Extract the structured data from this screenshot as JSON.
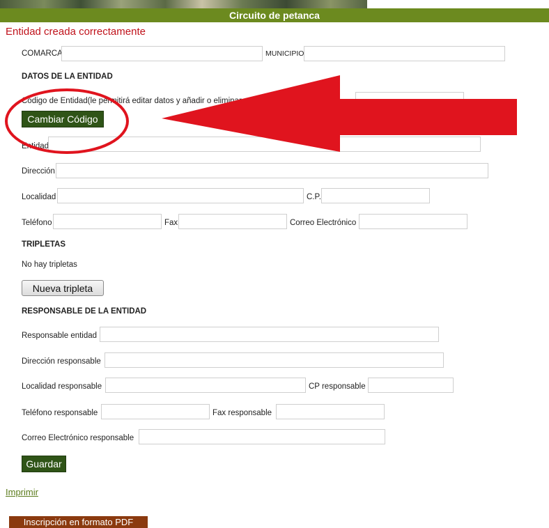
{
  "header": {
    "title": "Circuito de petanca"
  },
  "status": {
    "message": "Entidad creada correctamente"
  },
  "location": {
    "comarca_label": "COMARCA",
    "comarca_value": "",
    "municipio_label": "MUNICIPIO",
    "municipio_value": ""
  },
  "entity": {
    "section_title": "DATOS DE LA ENTIDAD",
    "code_label": "Código de Entidad(le permitirá editar datos y añadir o eliminar",
    "code_value": "",
    "change_code_button": "Cambiar Código",
    "name_label": "Entidad",
    "name_value": "",
    "address_label": "Dirección",
    "address_value": "",
    "locality_label": "Localidad",
    "locality_value": "",
    "cp_label": "C.P.",
    "cp_value": "",
    "phone_label": "Teléfono",
    "phone_value": "",
    "fax_label": "Fax",
    "fax_value": "",
    "email_label": "Correo Electrónico",
    "email_value": ""
  },
  "triplets": {
    "section_title": "TRIPLETAS",
    "empty_text": "No hay tripletas",
    "new_button": "Nueva tripleta"
  },
  "responsible": {
    "section_title": "RESPONSABLE DE LA ENTIDAD",
    "name_label": "Responsable entidad",
    "name_value": "",
    "address_label": "Dirección responsable",
    "address_value": "",
    "locality_label": "Localidad responsable",
    "locality_value": "",
    "cp_label": "CP responsable",
    "cp_value": "",
    "phone_label": "Teléfono responsable",
    "phone_value": "",
    "fax_label": "Fax responsable",
    "fax_value": "",
    "email_label": "Correo Electrónico responsable",
    "email_value": ""
  },
  "actions": {
    "save_button": "Guardar",
    "print_link": "Imprimir",
    "pdf_button": "Inscripción en formato PDF"
  },
  "annotation": {
    "color": "#e0141e"
  }
}
